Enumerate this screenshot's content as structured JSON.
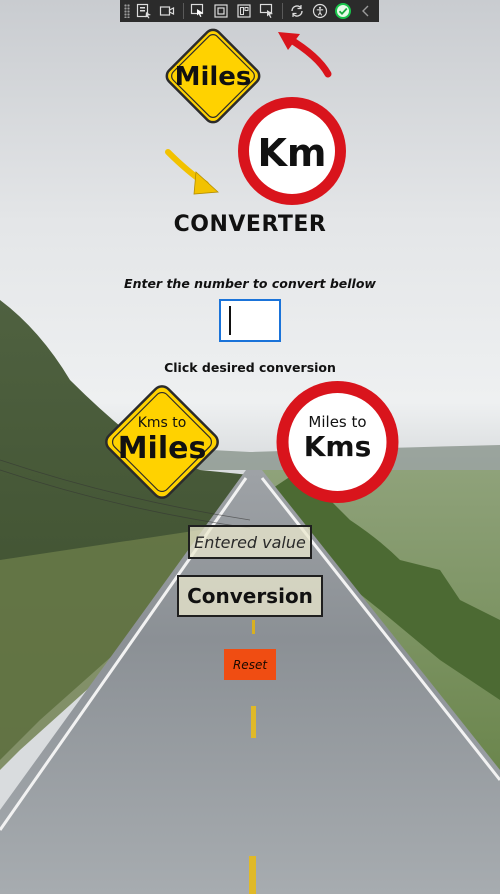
{
  "app": {
    "title": "CONVERTER",
    "logo_sign_miles": "Miles",
    "logo_sign_km": "Km"
  },
  "form": {
    "prompt": "Enter the number to convert bellow",
    "input_value": "",
    "instruction": "Click desired conversion"
  },
  "buttons": {
    "kms_to_miles": {
      "line1": "Kms to",
      "line2": "Miles"
    },
    "miles_to_kms": {
      "line1": "Miles to",
      "line2": "Kms"
    },
    "reset": "Reset"
  },
  "results": {
    "entered_value": "Entered value",
    "conversion": "Conversion"
  },
  "toolbar": {
    "icons": [
      "gripper-icon",
      "select-element-icon",
      "video-icon",
      "pointer-icon",
      "rect-select-icon",
      "layout-adorner-icon",
      "track-focus-icon",
      "hot-reload-icon",
      "accessibility-icon",
      "check-circle-icon",
      "collapse-chevron-icon"
    ]
  },
  "colors": {
    "yellow_sign": "#ffd200",
    "red_ring": "#d9141c",
    "reset_orange": "#f04d12",
    "input_border": "#1a73d9"
  }
}
